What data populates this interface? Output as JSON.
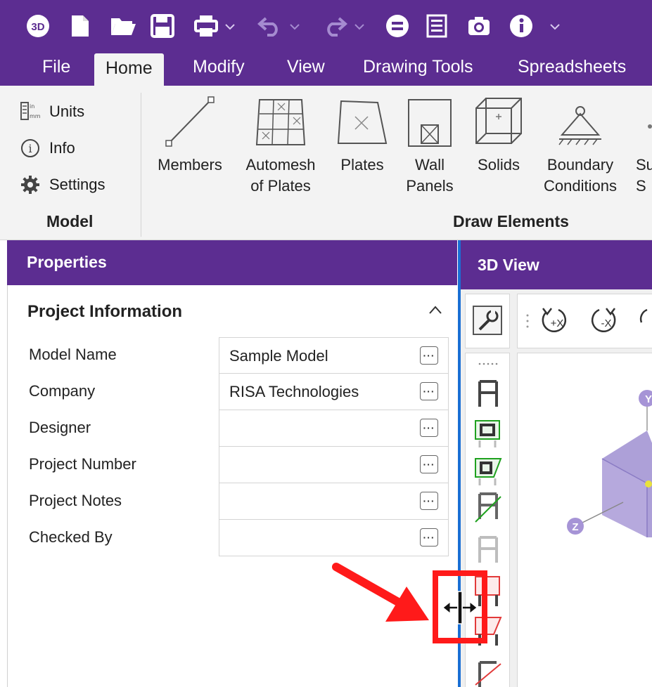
{
  "quick_access": {
    "items": [
      "3d-logo-icon",
      "new-file-icon",
      "open-folder-icon",
      "save-icon",
      "print-icon",
      "undo-icon",
      "redo-icon",
      "equals-icon",
      "report-icon",
      "camera-icon",
      "info-icon"
    ],
    "logo_text": "3D"
  },
  "menu": {
    "tabs": [
      "File",
      "Home",
      "Modify",
      "View",
      "Drawing Tools",
      "Spreadsheets"
    ],
    "active": "Home"
  },
  "ribbon": {
    "model_group": {
      "items": [
        {
          "label": "Units",
          "icon": "units-icon"
        },
        {
          "label": "Info",
          "icon": "info-circle-icon"
        },
        {
          "label": "Settings",
          "icon": "gear-icon"
        }
      ],
      "label": "Model"
    },
    "draw_group": {
      "buttons": [
        {
          "label": "Members",
          "icon": "member-line-icon"
        },
        {
          "label": "Automesh\nof Plates",
          "icon": "automesh-icon"
        },
        {
          "label": "Plates",
          "icon": "plate-icon"
        },
        {
          "label": "Wall\nPanels",
          "icon": "wall-panel-icon"
        },
        {
          "label": "Solids",
          "icon": "solid-cube-icon"
        },
        {
          "label": "Boundary\nConditions",
          "icon": "boundary-support-icon"
        },
        {
          "label": "Su\nS",
          "icon": "partial-icon"
        }
      ],
      "label": "Draw Elements"
    }
  },
  "properties": {
    "header": "Properties",
    "section": "Project Information",
    "rows": [
      {
        "label": "Model Name",
        "value": "Sample Model"
      },
      {
        "label": "Company",
        "value": "RISA Technologies"
      },
      {
        "label": "Designer",
        "value": ""
      },
      {
        "label": "Project Number",
        "value": ""
      },
      {
        "label": "Project Notes",
        "value": ""
      },
      {
        "label": "Checked By",
        "value": ""
      }
    ],
    "ellipsis": "···"
  },
  "view3d": {
    "header": "3D View",
    "rotate_buttons": [
      "+X",
      "-X"
    ],
    "axis_labels": {
      "y": "Y",
      "z": "Z"
    }
  },
  "colors": {
    "brand": "#5c2d91",
    "splitter": "#1a6fd4",
    "annotation": "#ff1a1a"
  }
}
